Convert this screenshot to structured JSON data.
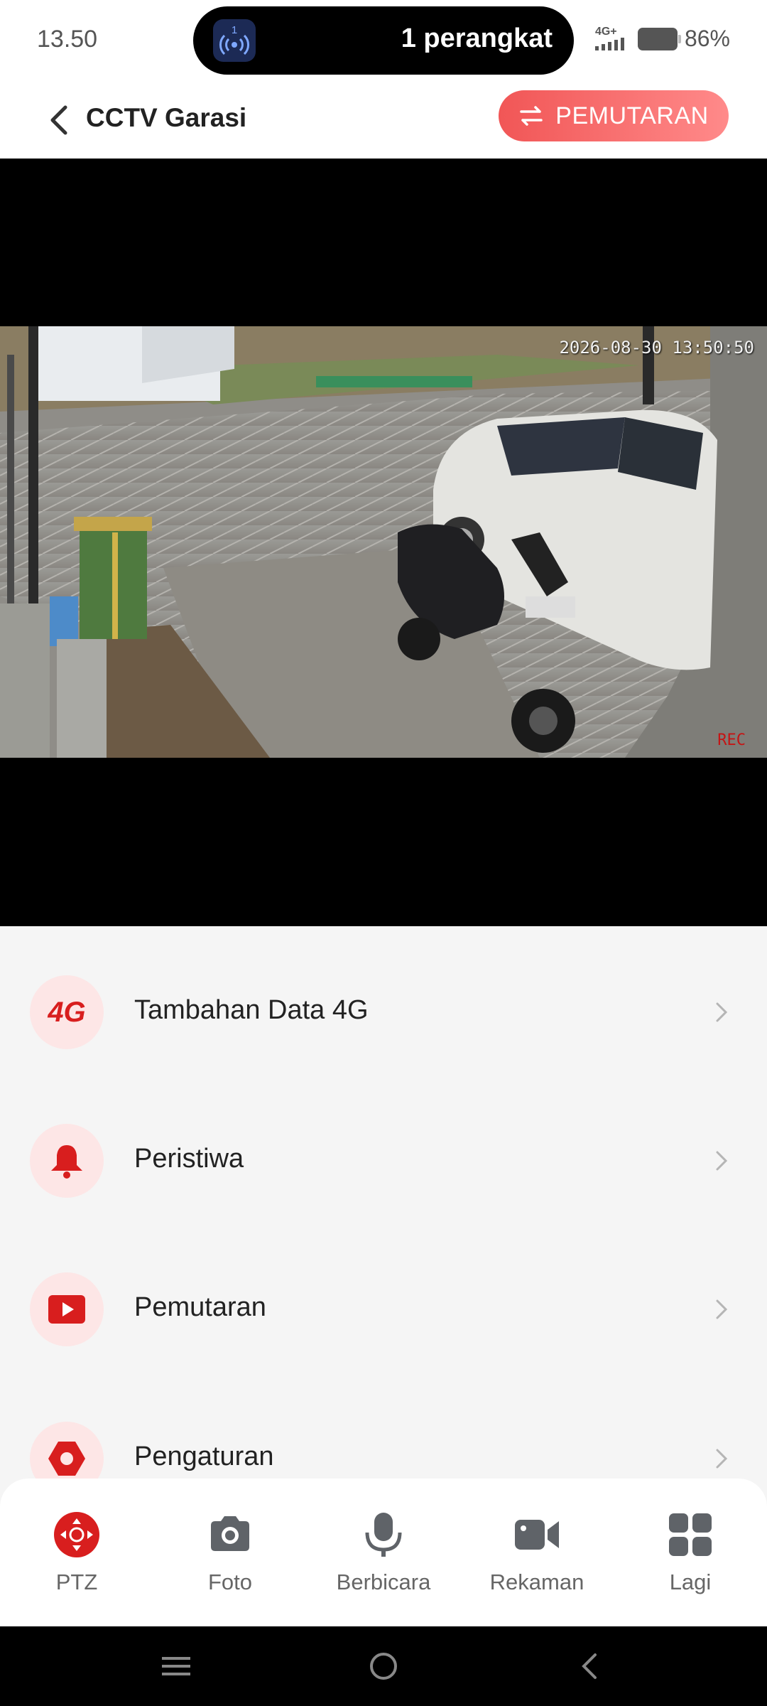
{
  "status_bar": {
    "time": "13.50",
    "pill_count": "1",
    "pill_text": "1 perangkat",
    "network": "4G+",
    "battery": "86%"
  },
  "header": {
    "title": "CCTV Garasi",
    "playback_button": "PEMUTARAN"
  },
  "video": {
    "timestamp": "2026-08-30 13:50:50",
    "rec": "REC"
  },
  "menu": [
    {
      "label": "Tambahan Data 4G",
      "icon_text": "4G",
      "icon": "4g-icon"
    },
    {
      "label": "Peristiwa",
      "icon": "bell-icon"
    },
    {
      "label": "Pemutaran",
      "icon": "play-icon"
    },
    {
      "label": "Pengaturan",
      "icon": "gear-icon"
    }
  ],
  "toolbar": [
    {
      "label": "PTZ",
      "icon": "ptz-icon",
      "active": true
    },
    {
      "label": "Foto",
      "icon": "camera-icon"
    },
    {
      "label": "Berbicara",
      "icon": "microphone-icon"
    },
    {
      "label": "Rekaman",
      "icon": "video-camera-icon"
    },
    {
      "label": "Lagi",
      "icon": "grid-icon"
    }
  ],
  "colors": {
    "accent": "#d81e1e",
    "accent_soft": "#fde6e6",
    "icon_gray": "#5f6368"
  }
}
